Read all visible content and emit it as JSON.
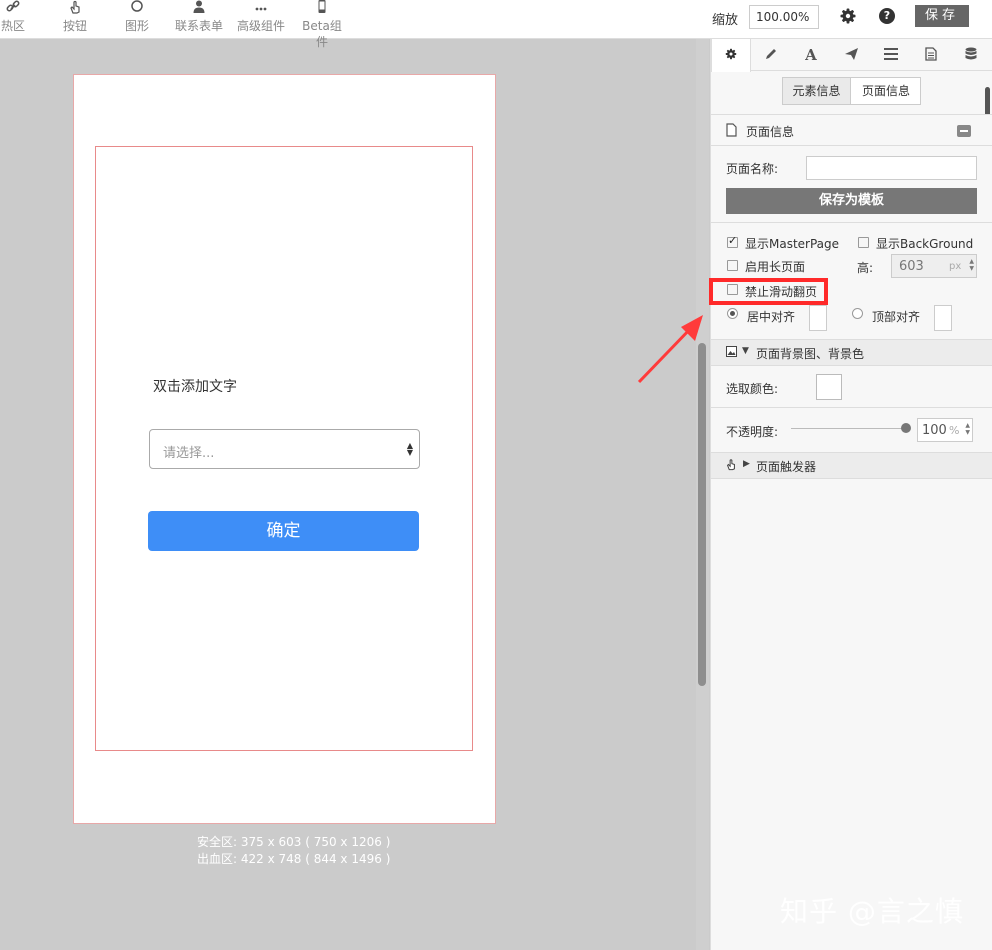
{
  "toolbar": {
    "tools": [
      {
        "icon": "link-icon",
        "label": "热区"
      },
      {
        "icon": "hand-pointer-icon",
        "label": "按钮"
      },
      {
        "icon": "circle-icon",
        "label": "图形"
      },
      {
        "icon": "user-icon",
        "label": "联系表单"
      },
      {
        "icon": "ellipsis-icon",
        "label": "高级组件"
      },
      {
        "icon": "mobile-icon",
        "label": "Beta组件"
      }
    ],
    "zoom_label": "缩放",
    "zoom_value": "100.00%",
    "save_label": "保存"
  },
  "canvas": {
    "text_element": "双击添加文字",
    "select_placeholder": "请选择...",
    "confirm_button": "确定",
    "safe_area": "安全区: 375 x 603 ( 750 x 1206 )",
    "bleed_area": "出血区: 422 x 748 ( 844 x 1496 )"
  },
  "panel": {
    "tabs": [
      "gear-icon",
      "pencil-icon",
      "font-icon",
      "paper-plane-icon",
      "list-icon",
      "file-text-icon",
      "database-icon"
    ],
    "active_tab": 0,
    "subtabs": {
      "element_info": "元素信息",
      "page_info": "页面信息"
    },
    "page_info_section": {
      "title": "页面信息",
      "page_name_label": "页面名称:",
      "page_name_value": "",
      "save_template_button": "保存为模板"
    },
    "options": {
      "show_masterpage": {
        "label": "显示MasterPage",
        "checked": true
      },
      "show_background": {
        "label": "显示BackGround",
        "checked": false
      },
      "long_page": {
        "label": "启用长页面",
        "checked": false
      },
      "height_label": "高:",
      "height_value": "603",
      "height_unit": "px",
      "disable_swipe": {
        "label": "禁止滑动翻页",
        "checked": false
      },
      "center_align": {
        "label": "居中对齐",
        "selected": true
      },
      "top_align": {
        "label": "顶部对齐",
        "selected": false
      }
    },
    "background_section": {
      "title": "页面背景图、背景色",
      "pick_color_label": "选取颜色:",
      "opacity_label": "不透明度:",
      "opacity_value": "100",
      "opacity_unit": "%"
    },
    "trigger_section": {
      "title": "页面触发器"
    }
  },
  "watermark": "知乎 @言之慎",
  "colors": {
    "primary_button": "#3e8ef7",
    "highlight": "#ff2a2a",
    "arrow": "#ff3b3b"
  }
}
